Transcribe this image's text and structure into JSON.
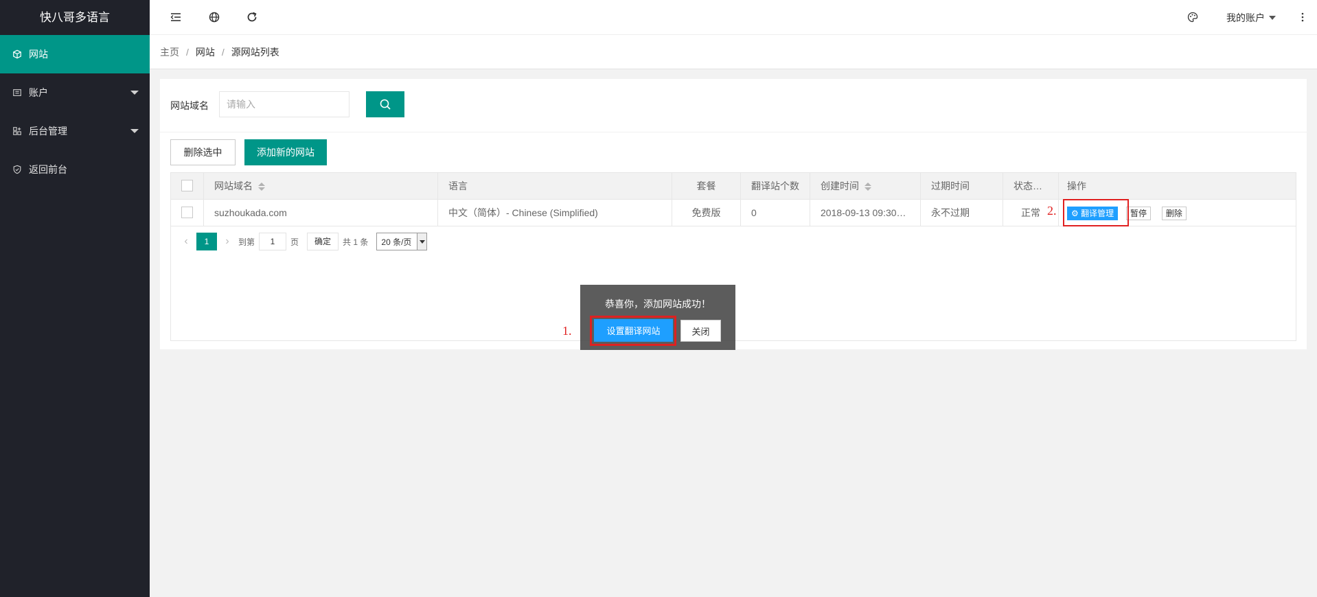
{
  "app": {
    "title": "快八哥多语言"
  },
  "sidebar": {
    "items": [
      {
        "label": "网站",
        "icon": "cube-icon",
        "active": true
      },
      {
        "label": "账户",
        "icon": "account-icon"
      },
      {
        "label": "后台管理",
        "icon": "apps-icon"
      },
      {
        "label": "返回前台",
        "icon": "shield-icon"
      }
    ]
  },
  "header": {
    "icons": [
      "menu-fold-icon",
      "globe-icon",
      "refresh-icon",
      "palette-icon",
      "more-icon"
    ],
    "account_label": "我的账户"
  },
  "breadcrumb": {
    "home": "主页",
    "section": "网站",
    "current": "源网站列表",
    "separator": "/"
  },
  "search": {
    "label": "网站域名",
    "placeholder": "请输入"
  },
  "toolbar": {
    "delete_selected": "删除选中",
    "add_site": "添加新的网站"
  },
  "table": {
    "headers": [
      "网站域名",
      "语言",
      "套餐",
      "翻译站个数",
      "创建时间",
      "过期时间",
      "状态…",
      "操作"
    ],
    "rows": [
      {
        "domain": "suzhoukada.com",
        "language": "中文（简体）- Chinese (Simplified)",
        "plan": "免费版",
        "count": "0",
        "created": "2018-09-13 09:30…",
        "expire": "永不过期",
        "status": "正常",
        "actions": {
          "manage": "翻译管理",
          "pause": "暂停",
          "delete": "删除"
        }
      }
    ]
  },
  "pager": {
    "current_page": "1",
    "goto_label": "到第",
    "page_input": "1",
    "page_suffix": "页",
    "confirm": "确定",
    "total": "共 1 条",
    "per_page": "20 条/页"
  },
  "dialog": {
    "message": "恭喜你，添加网站成功！",
    "primary": "设置翻译网站",
    "close": "关闭"
  },
  "annotations": {
    "mark1": "1.",
    "mark2": "2."
  },
  "colors": {
    "sidebar": "#20222a",
    "accent": "#009688",
    "blue": "#1e9fff",
    "highlight": "#e02020"
  }
}
